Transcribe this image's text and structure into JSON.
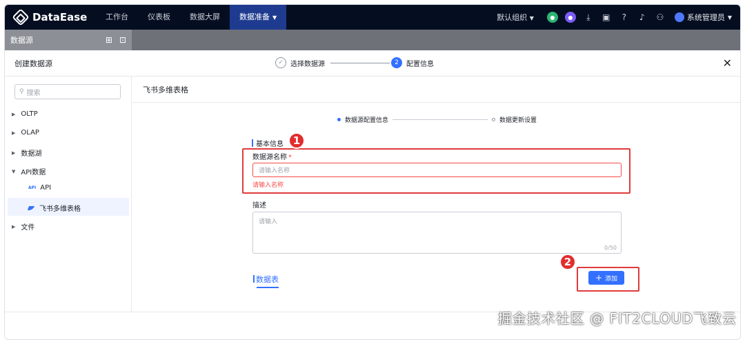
{
  "topnav": {
    "brand": "DataEase",
    "items": [
      {
        "label": "工作台"
      },
      {
        "label": "仪表板"
      },
      {
        "label": "数据大屏"
      },
      {
        "label": "数据准备"
      }
    ],
    "org": "默认组织",
    "user": "系统管理员"
  },
  "bgpanel": {
    "title": "数据源"
  },
  "dialog": {
    "title": "创建数据源",
    "steps": [
      {
        "label": "选择数据源",
        "index": "1"
      },
      {
        "label": "配置信息",
        "index": "2"
      }
    ]
  },
  "sidebar": {
    "search_placeholder": "搜索",
    "items": [
      {
        "label": "OLTP"
      },
      {
        "label": "OLAP"
      },
      {
        "label": "数据湖"
      },
      {
        "label": "API数据"
      },
      {
        "label": "文件"
      }
    ],
    "sub_items": [
      {
        "label": "API",
        "icon_text": "API"
      },
      {
        "label": "飞书多维表格"
      }
    ]
  },
  "main": {
    "title": "飞书多维表格",
    "sub_steps": [
      {
        "label": "数据源配置信息"
      },
      {
        "label": "数据更新设置"
      }
    ],
    "section_basic": "基本信息",
    "name_label": "数据源名称",
    "name_placeholder": "请输入名称",
    "name_error": "请输入名称",
    "desc_label": "描述",
    "desc_placeholder": "请输入",
    "desc_counter": "0/50",
    "tables_tab": "数据表",
    "add_button": "添加"
  },
  "annotations": {
    "badge1": "1",
    "badge2": "2"
  },
  "watermark": "掘金技术社区 @ FIT2CLOUD飞致云",
  "colors": {
    "accent": "#3370ff",
    "error": "#f54a45",
    "nav_bg": "#050e21",
    "annotation_red": "#e22d2d"
  }
}
